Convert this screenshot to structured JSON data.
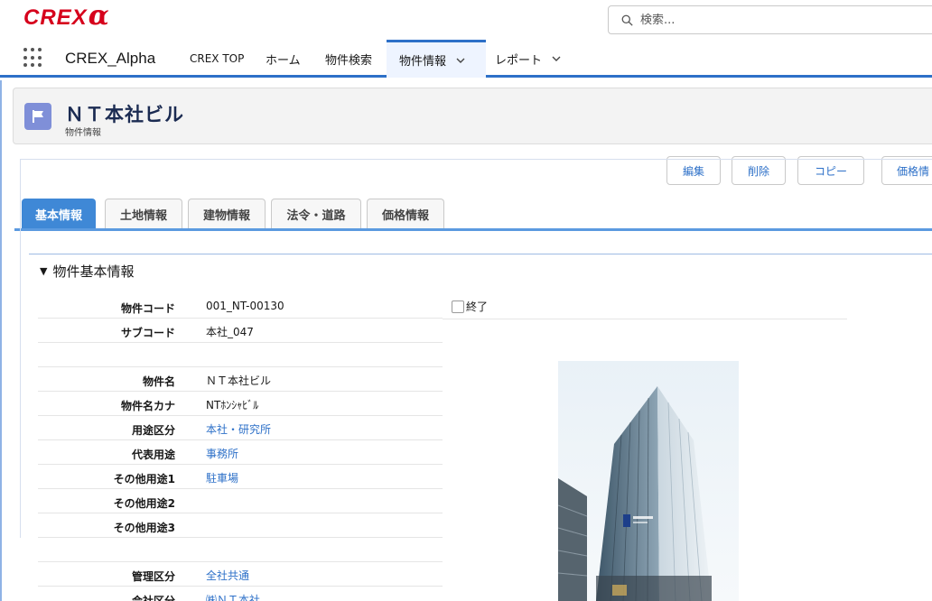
{
  "header": {
    "search_placeholder": "検索..."
  },
  "logo": {
    "text": "CREX",
    "alpha": "α"
  },
  "nav": {
    "app_name": "CREX_Alpha",
    "items": [
      {
        "label": "CREX TOP"
      },
      {
        "label": "ホーム"
      },
      {
        "label": "物件検索"
      },
      {
        "label": "物件情報"
      },
      {
        "label": "レポート"
      }
    ]
  },
  "record": {
    "title": "ＮＴ本社ビル",
    "type": "物件情報"
  },
  "actions": [
    "編集",
    "削除",
    "コピー",
    "価格情"
  ],
  "tabs": [
    "基本情報",
    "土地情報",
    "建物情報",
    "法令・道路",
    "価格情報"
  ],
  "section": {
    "title": "物件基本情報",
    "checkbox_label": "終了",
    "checkbox_checked": false
  },
  "fields": [
    {
      "label": "物件コード",
      "value": "001_NT-00130"
    },
    {
      "label": "サブコード",
      "value": "本社_047"
    },
    {
      "label": "",
      "value": ""
    },
    {
      "label": "物件名",
      "value": "ＮＴ本社ビル"
    },
    {
      "label": "物件名カナ",
      "value": "NTﾎﾝｼｬﾋﾞﾙ"
    },
    {
      "label": "用途区分",
      "value": "本社・研究所"
    },
    {
      "label": "代表用途",
      "value": "事務所"
    },
    {
      "label": "その他用途1",
      "value": "駐車場"
    },
    {
      "label": "その他用途2",
      "value": ""
    },
    {
      "label": "その他用途3",
      "value": ""
    },
    {
      "label": "",
      "value": ""
    },
    {
      "label": "管理区分",
      "value": "全社共通"
    },
    {
      "label": "会社区分",
      "value": "㈱ＮＴ本社"
    }
  ],
  "colors": {
    "brand": "#d6001c",
    "accent": "#2d70c8",
    "tab_active": "#3f88d6"
  }
}
